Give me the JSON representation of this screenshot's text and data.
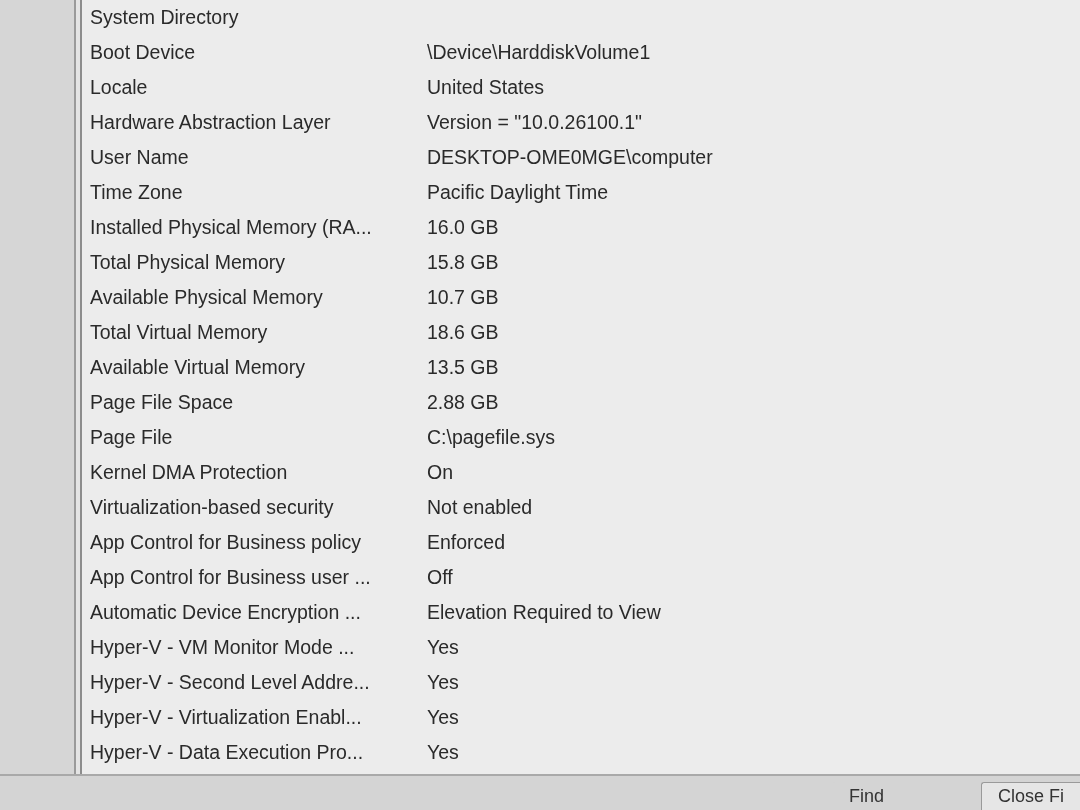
{
  "details_list": {
    "rows": [
      {
        "column_1": "System Directory"
      },
      {
        "column_1": "Boot Device",
        "column_2": "\\Device\\HarddiskVolume1"
      },
      {
        "column_1": "Locale",
        "column_2": "United States"
      },
      {
        "column_1": "Hardware Abstraction Layer",
        "column_2": "Version = \"10.0.26100.1\""
      },
      {
        "column_1": "User Name",
        "column_2": "DESKTOP-OME0MGE\\computer"
      },
      {
        "column_1": "Time Zone",
        "column_2": "Pacific Daylight Time"
      },
      {
        "column_1": "Installed Physical Memory (RA...",
        "column_2": "16.0 GB"
      },
      {
        "column_1": "Total Physical Memory",
        "column_2": "15.8 GB"
      },
      {
        "column_1": "Available Physical Memory",
        "column_2": "10.7 GB"
      },
      {
        "column_1": "Total Virtual Memory",
        "column_2": "18.6 GB"
      },
      {
        "column_1": "Available Virtual Memory",
        "column_2": "13.5 GB"
      },
      {
        "column_1": "Page File Space",
        "column_2": "2.88 GB"
      },
      {
        "column_1": "Page File",
        "column_2": "C:\\pagefile.sys"
      },
      {
        "column_1": "Kernel DMA Protection",
        "column_2": "On"
      },
      {
        "column_1": "Virtualization-based security",
        "column_2": "Not enabled"
      },
      {
        "column_1": "App Control for Business policy",
        "column_2": "Enforced"
      },
      {
        "column_1": "App Control for Business user ...",
        "column_2": "Off"
      },
      {
        "column_1": "Automatic Device Encryption ...",
        "column_2": "Elevation Required to View"
      },
      {
        "column_1": "Hyper-V - VM Monitor Mode ...",
        "column_2": "Yes"
      },
      {
        "column_1": "Hyper-V - Second Level Addre...",
        "column_2": "Yes"
      },
      {
        "column_1": "Hyper-V - Virtualization Enabl...",
        "column_2": "Yes"
      },
      {
        "column_1": "Hyper-V - Data Execution Pro...",
        "column_2": "Yes"
      }
    ]
  },
  "find_bar": {
    "buttons": [
      "Find",
      "Close Fi"
    ]
  }
}
